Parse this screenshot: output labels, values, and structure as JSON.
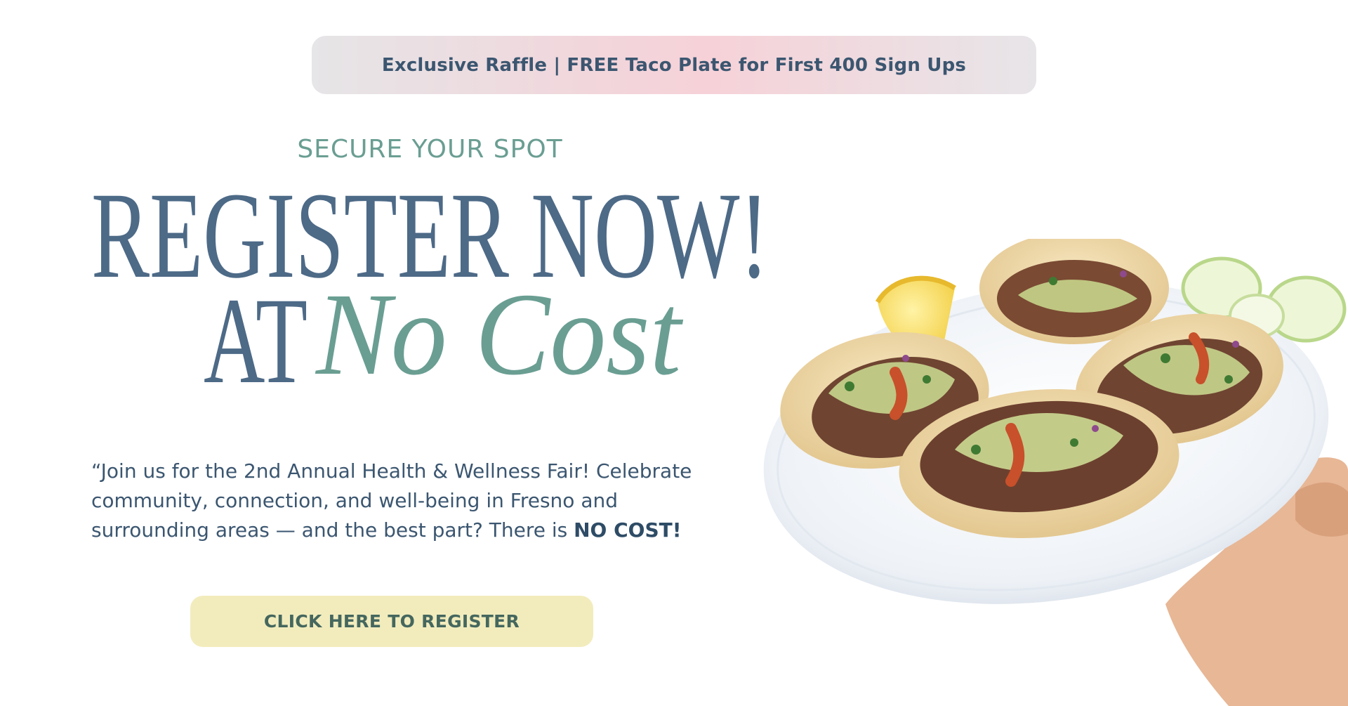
{
  "banner": {
    "text": "Exclusive Raffle | FREE Taco Plate for First 400 Sign Ups"
  },
  "hero": {
    "eyebrow": "SECURE YOUR SPOT",
    "headline_line1": "REGISTER NOW!",
    "headline_at": "AT",
    "headline_script": "No Cost",
    "body_text": "“Join us for the 2nd Annual Health & Wellness Fair! Celebrate community, connection, and well-being in Fresno and surrounding areas — and the best part? There is ",
    "body_emphasis": "NO COST!"
  },
  "cta": {
    "label": "CLICK HERE TO REGISTER"
  },
  "colors": {
    "navy": "#4d6a87",
    "teal": "#6a9e92",
    "cta_bg": "#f2ecbd",
    "banner_pink": "#f6d2d8"
  },
  "image": {
    "subject": "plate of tacos held by hand"
  }
}
